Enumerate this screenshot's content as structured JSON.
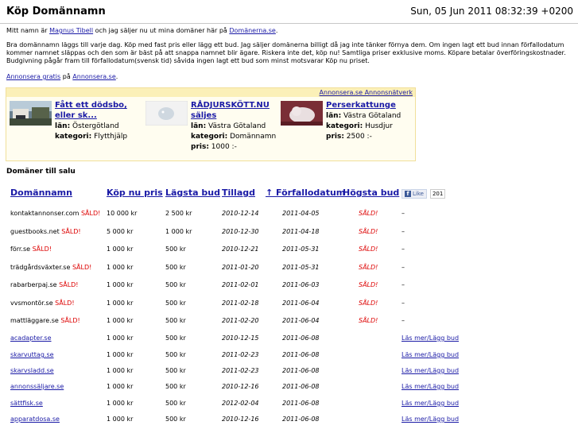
{
  "header": {
    "title": "Köp Domännamn",
    "datetime": "Sun, 05 Jun 2011 08:32:39 +0200"
  },
  "intro": {
    "text1": "Mitt namn är ",
    "name_link": "Magnus Tibell",
    "text2": " och jag säljer nu ut mina domäner här på ",
    "site_link": "Domänerna.se",
    "text3": ".",
    "paragraph": "Bra domännamn läggs till varje dag. Köp med fast pris eller lägg ett bud. Jag säljer domänerna billigt då jag inte tänker förnya dem. Om ingen lagt ett bud innan förfallodatum kommer namnet släppas och den som är bäst på att snappa namnet blir ägare. Riskera inte det, köp nu! Samtliga priser exklusive moms. Köpare betalar överföringskostnader. Budgivning pågår fram till förfallodatum(svensk tid) såvida ingen lagt ett bud som minst motsvarar Köp nu priset.",
    "annonsera_link": "Annonsera gratis",
    "pa": " på ",
    "annonsera_site": "Annonsera.se",
    "dot": "."
  },
  "ads": {
    "network_link": "Annonsera.se Annonsnätverk",
    "items": [
      {
        "title": "Fått ett dödsbo, eller sk...",
        "lines": [
          {
            "k": "län:",
            "v": "Östergötland"
          },
          {
            "k": "kategori:",
            "v": "Flytthjälp"
          }
        ]
      },
      {
        "title": "RÅDJURSKÖTT.NU säljes",
        "lines": [
          {
            "k": "län:",
            "v": "Västra Götaland"
          },
          {
            "k": "kategori:",
            "v": "Domännamn"
          },
          {
            "k": "pris:",
            "v": "1000 :-"
          }
        ]
      },
      {
        "title": "Perserkattunge",
        "lines": [
          {
            "k": "län:",
            "v": "Västra Götaland"
          },
          {
            "k": "kategori:",
            "v": "Husdjur"
          },
          {
            "k": "pris:",
            "v": "2500 :-"
          }
        ]
      }
    ]
  },
  "table": {
    "section_title": "Domäner till salu",
    "headers": [
      "Domännamn",
      "Köp nu pris",
      "Lägsta bud",
      "Tillagd",
      "↑ Förfallodatum",
      "Högsta bud"
    ],
    "fb_like": "Like",
    "fb_count": "201",
    "sold_label": "SÅLD!",
    "action_label": "Läs mer/Lägg bud",
    "dash": "–",
    "rows": [
      {
        "name": "kontaktannonser.com",
        "sold": true,
        "price": "10 000 kr",
        "min": "2 500 kr",
        "added": "2010-12-14",
        "expires": "2011-04-05"
      },
      {
        "name": "guestbooks.net",
        "sold": true,
        "price": "5 000 kr",
        "min": "1 000 kr",
        "added": "2010-12-30",
        "expires": "2011-04-18"
      },
      {
        "name": "förr.se",
        "sold": true,
        "price": "1 000 kr",
        "min": "500 kr",
        "added": "2010-12-21",
        "expires": "2011-05-31"
      },
      {
        "name": "trädgårdsväxter.se",
        "sold": true,
        "price": "1 000 kr",
        "min": "500 kr",
        "added": "2011-01-20",
        "expires": "2011-05-31"
      },
      {
        "name": "rabarberpaj.se",
        "sold": true,
        "price": "1 000 kr",
        "min": "500 kr",
        "added": "2011-02-01",
        "expires": "2011-06-03"
      },
      {
        "name": "vvsmontör.se",
        "sold": true,
        "price": "1 000 kr",
        "min": "500 kr",
        "added": "2011-02-18",
        "expires": "2011-06-04"
      },
      {
        "name": "mattläggare.se",
        "sold": true,
        "price": "1 000 kr",
        "min": "500 kr",
        "added": "2011-02-20",
        "expires": "2011-06-04"
      },
      {
        "name": "acadapter.se",
        "sold": false,
        "price": "1 000 kr",
        "min": "500 kr",
        "added": "2010-12-15",
        "expires": "2011-06-08"
      },
      {
        "name": "skarvuttag.se",
        "sold": false,
        "price": "1 000 kr",
        "min": "500 kr",
        "added": "2011-02-23",
        "expires": "2011-06-08"
      },
      {
        "name": "skarvsladd.se",
        "sold": false,
        "price": "1 000 kr",
        "min": "500 kr",
        "added": "2011-02-23",
        "expires": "2011-06-08"
      },
      {
        "name": "annonssäljare.se",
        "sold": false,
        "price": "1 000 kr",
        "min": "500 kr",
        "added": "2010-12-16",
        "expires": "2011-06-08"
      },
      {
        "name": "sättfisk.se",
        "sold": false,
        "price": "1 000 kr",
        "min": "500 kr",
        "added": "2012-02-04",
        "expires": "2011-06-08"
      },
      {
        "name": "apparatdosa.se",
        "sold": false,
        "price": "1 000 kr",
        "min": "500 kr",
        "added": "2010-12-16",
        "expires": "2011-06-08"
      }
    ]
  }
}
